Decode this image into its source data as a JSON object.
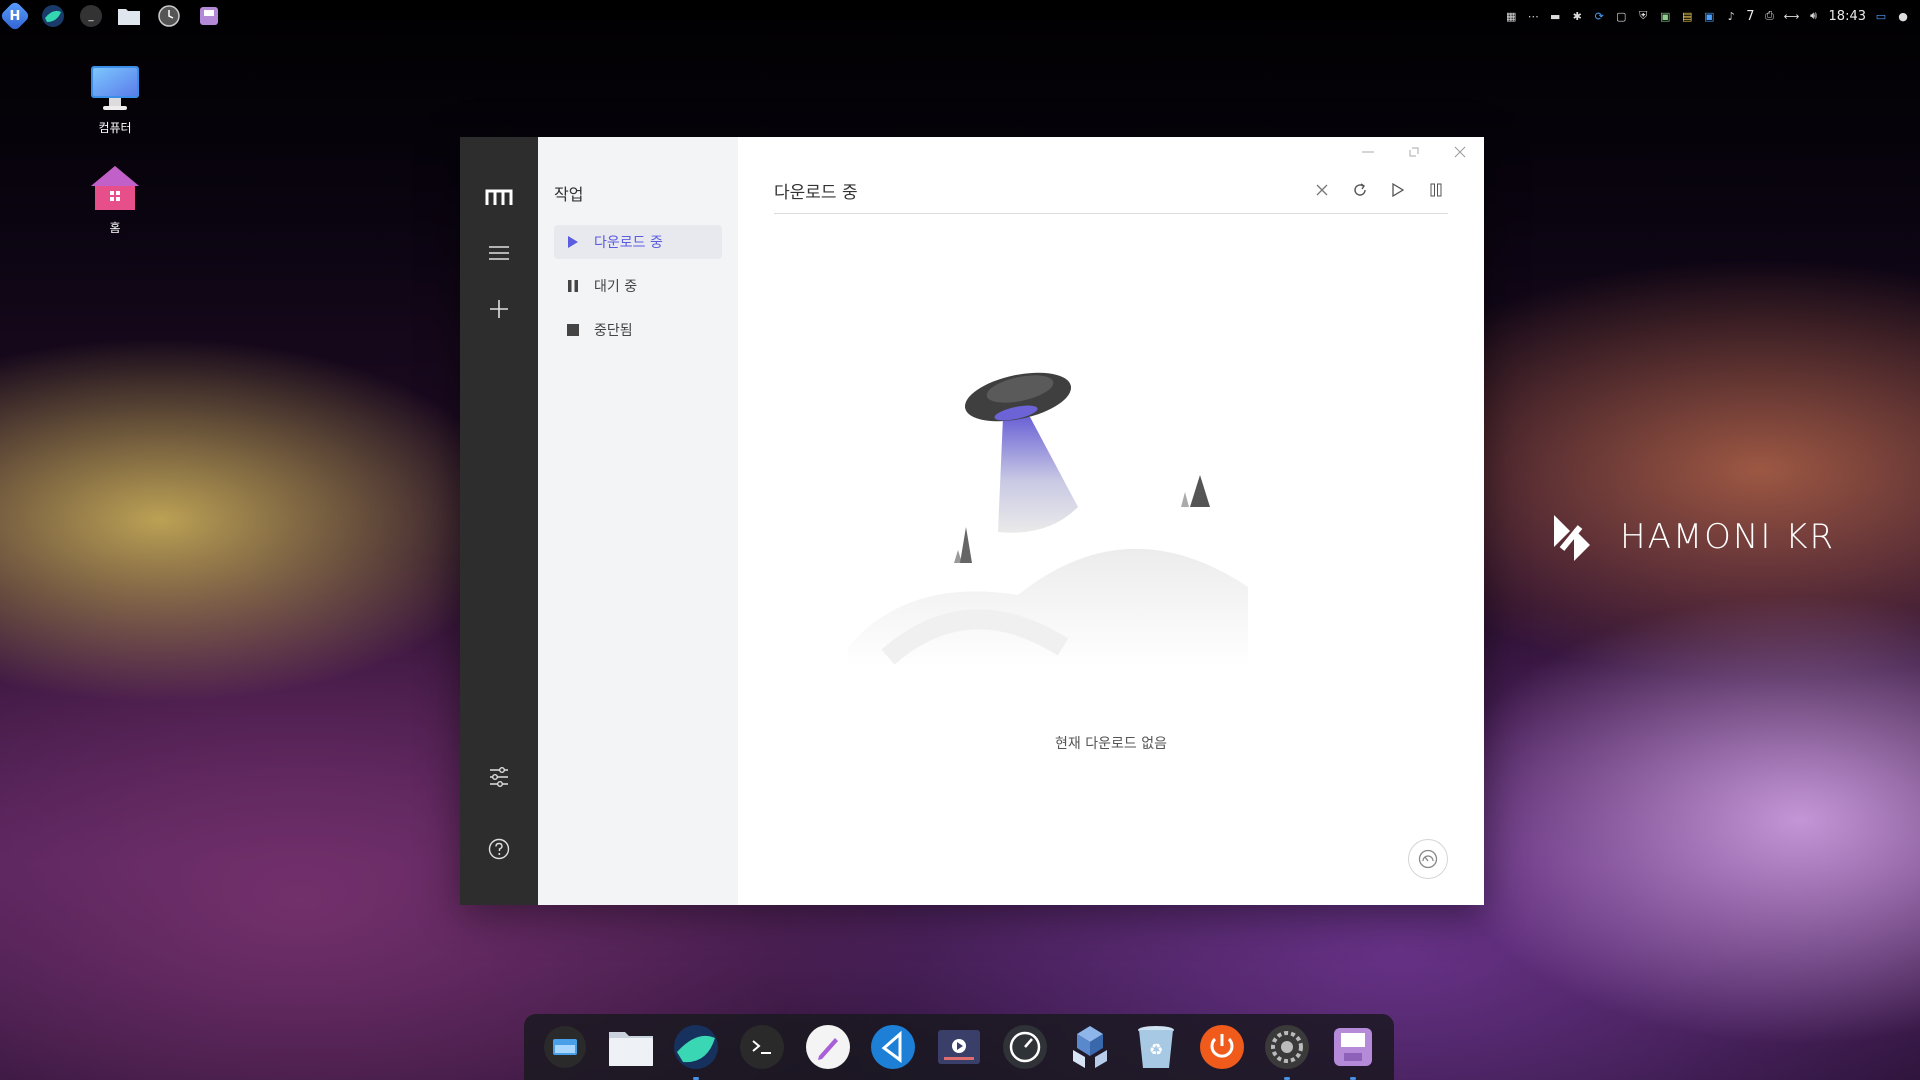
{
  "desktop": {
    "icons": [
      {
        "label": "컴퓨터"
      },
      {
        "label": "홈"
      }
    ],
    "brand": "HAMONI KR"
  },
  "top_panel": {
    "left_icons": [
      "hamonikr-menu-icon",
      "whale-browser-icon",
      "terminal-icon",
      "files-icon",
      "timeshift-icon",
      "disk-icon"
    ],
    "tray_count": "7",
    "clock": "18:43"
  },
  "window": {
    "sidebar": {
      "title": "작업",
      "items": [
        {
          "label": "다운로드 중",
          "icon": "play-icon",
          "active": true
        },
        {
          "label": "대기 중",
          "icon": "pause-icon",
          "active": false
        },
        {
          "label": "중단됨",
          "icon": "stop-icon",
          "active": false
        }
      ]
    },
    "main": {
      "title": "다운로드 중",
      "empty_message": "현재 다운로드 없음"
    },
    "colors": {
      "accent": "#5b5ce0",
      "rail": "#2d2d2d",
      "subnav": "#f3f4f6"
    }
  },
  "dock": {
    "items": [
      "screenshot-icon",
      "files-icon",
      "whale-browser-icon",
      "terminal-icon",
      "text-editor-icon",
      "vscode-icon",
      "video-player-icon",
      "speedometer-icon",
      "package-icon",
      "trash-icon",
      "power-icon",
      "settings-icon",
      "disk-icon"
    ]
  }
}
